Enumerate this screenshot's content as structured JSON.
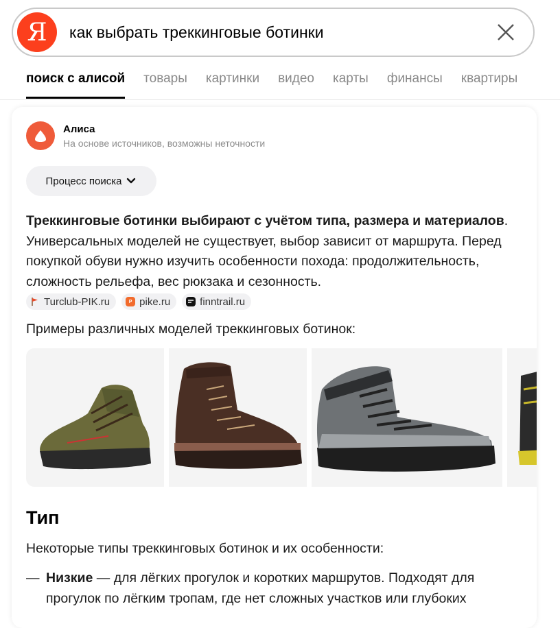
{
  "search": {
    "logo_letter": "Я",
    "query": "как выбрать треккинговые ботинки",
    "brand_color": "#fc3f1d"
  },
  "tabs": [
    {
      "label": "поиск с алисой",
      "active": true
    },
    {
      "label": "товары"
    },
    {
      "label": "картинки"
    },
    {
      "label": "видео"
    },
    {
      "label": "карты"
    },
    {
      "label": "финансы"
    },
    {
      "label": "квартиры"
    }
  ],
  "alice": {
    "name": "Алиса",
    "subtitle": "На основе источников, возможны неточности",
    "process_label": "Процесс поиска",
    "answer_bold": "Треккинговые ботинки выбирают с учётом типа, размера и материалов",
    "answer_rest": ". Универсальных моделей не существует, выбор зависит от маршрута. Перед покупкой обуви нужно изучить особенности похода: продолжительность, сложность рельефа, вес рюкзака и сезонность.",
    "sources": [
      {
        "label": "Turclub-PIK.ru",
        "icon": "flag-icon"
      },
      {
        "label": "pike.ru",
        "icon": "pike-icon"
      },
      {
        "label": "finntrail.ru",
        "icon": "finntrail-icon"
      }
    ],
    "examples_label": "Примеры различных моделей треккинговых ботинок:",
    "section_title": "Тип",
    "section_intro": "Некоторые типы треккинговых ботинок и их особенности:",
    "bullet_dash": "—",
    "bullet_bold": "Низкие",
    "bullet_rest": " — для лёгких прогулок и коротких маршрутов. Подходят для прогулок по лёгким тропам, где нет сложных участков или глубоких"
  }
}
